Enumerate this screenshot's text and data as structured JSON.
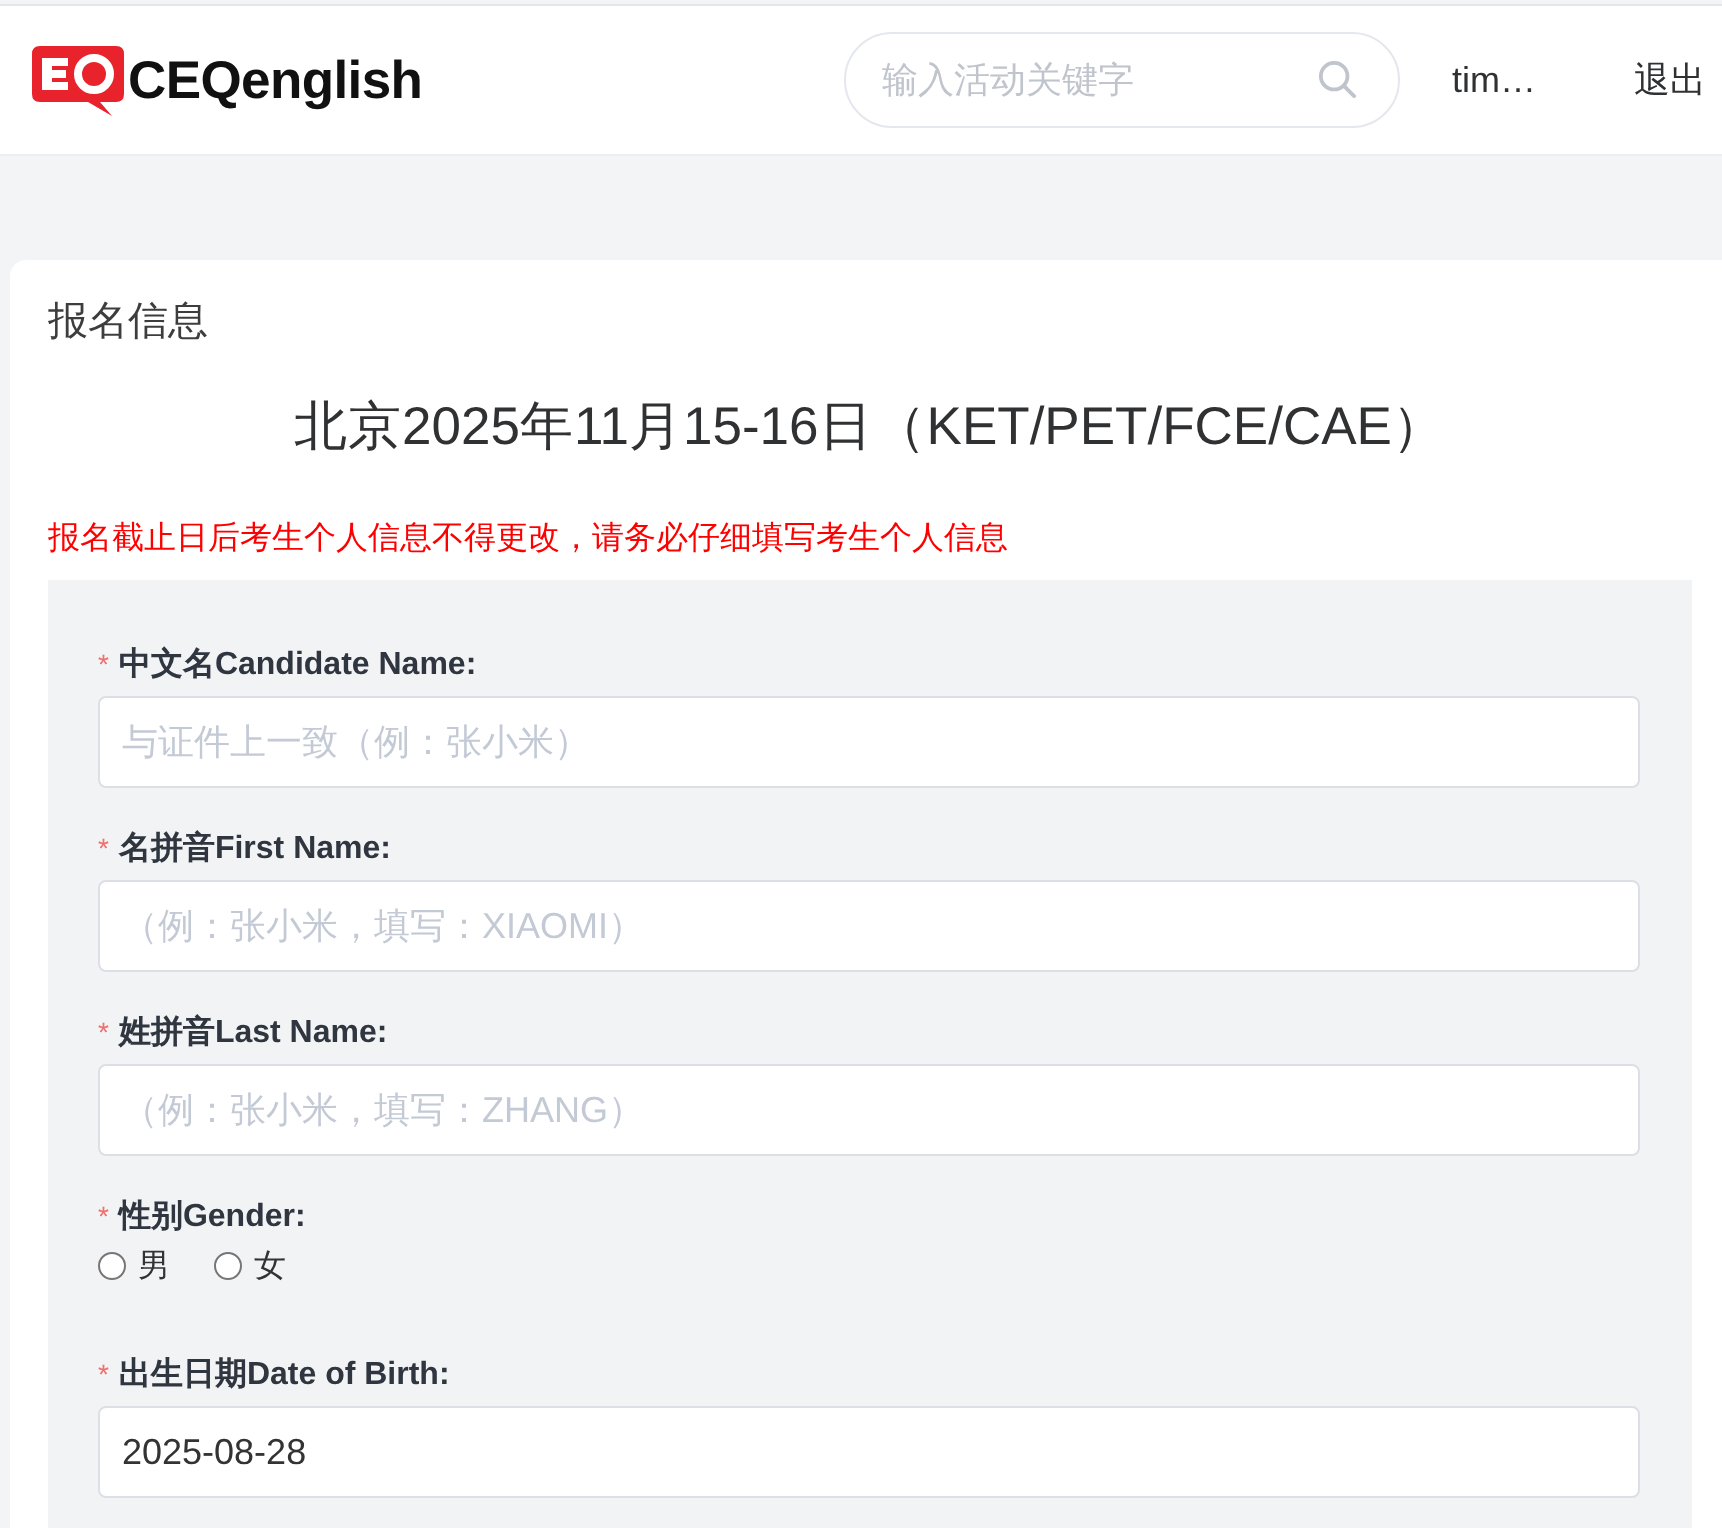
{
  "header": {
    "logo_text": "CEQenglish",
    "search": {
      "placeholder": "输入活动关键字"
    },
    "user": "tim…",
    "logout": "退出"
  },
  "card": {
    "heading": "报名信息",
    "event_title": "北京2025年11月15-16日（KET/PET/FCE/CAE）",
    "notice": "报名截止日后考生个人信息不得更改，请务必仔细填写考生个人信息",
    "fields": [
      {
        "kind": "text",
        "mark": "*",
        "label": "中文名Candidate Name:",
        "placeholder": "与证件上一致（例：张小米）"
      },
      {
        "kind": "text",
        "mark": "*",
        "label": "名拼音First Name:",
        "placeholder": "（例：张小米，填写：XIAOMI）"
      },
      {
        "kind": "text",
        "mark": "*",
        "label": "姓拼音Last Name:",
        "placeholder": "（例：张小米，填写：ZHANG）"
      },
      {
        "kind": "radio",
        "mark": "*",
        "label": "性别Gender:",
        "options": [
          {
            "label": "男",
            "selected": false
          },
          {
            "label": "女",
            "selected": false
          }
        ]
      },
      {
        "kind": "date",
        "mark": "*",
        "label": "出生日期Date of Birth:",
        "value": "2025-08-28"
      }
    ]
  }
}
